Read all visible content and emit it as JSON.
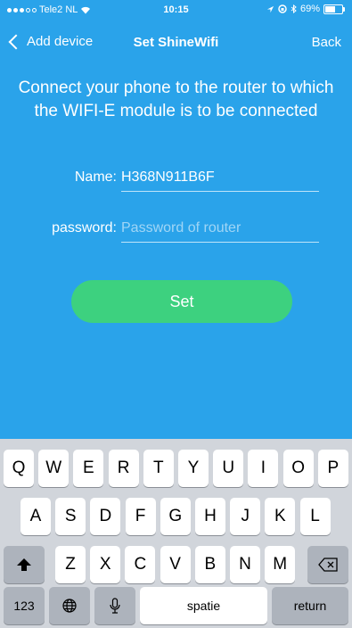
{
  "status_bar": {
    "carrier": "Tele2 NL",
    "time": "10:15",
    "battery": "69%",
    "battery_level": 0.69
  },
  "nav": {
    "back_label": "Add device",
    "title": "Set ShineWifi",
    "right_label": "Back"
  },
  "instruction": "Connect your phone to the router to which the WIFI-E module is to be connected",
  "form": {
    "name_label": "Name:",
    "name_value": "H368N911B6F",
    "password_label": "password:",
    "password_placeholder": "Password of router",
    "set_label": "Set"
  },
  "keyboard": {
    "row1": [
      "Q",
      "W",
      "E",
      "R",
      "T",
      "Y",
      "U",
      "I",
      "O",
      "P"
    ],
    "row2": [
      "A",
      "S",
      "D",
      "F",
      "G",
      "H",
      "J",
      "K",
      "L"
    ],
    "row3": [
      "Z",
      "X",
      "C",
      "V",
      "B",
      "N",
      "M"
    ],
    "numbers_label": "123",
    "space_label": "spatie",
    "return_label": "return"
  }
}
